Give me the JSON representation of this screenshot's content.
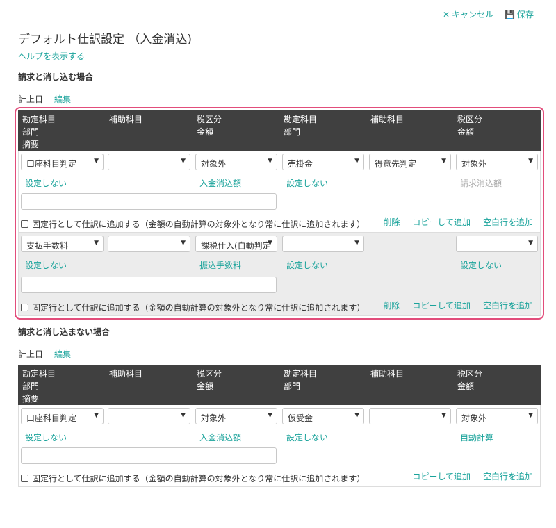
{
  "toolbar": {
    "cancel_label": "キャンセル",
    "save_label": "保存",
    "cancel_icon": "✕",
    "save_icon": "💾"
  },
  "page": {
    "title": "デフォルト仕訳設定 （入金消込)",
    "help_link": "ヘルプを表示する"
  },
  "headers": {
    "col1": [
      "勘定科目",
      "部門",
      "摘要"
    ],
    "col2": [
      "補助科目"
    ],
    "col3": [
      "税区分",
      "金額"
    ],
    "col4": [
      "勘定科目",
      "部門"
    ],
    "col5": [
      "補助科目"
    ],
    "col6": [
      "税区分",
      "金額"
    ]
  },
  "common": {
    "fixed_row_label": "固定行として仕訳に追加する（金額の自動計算の対象外となり常に仕訳に追加されます）",
    "delete_label": "削除",
    "copy_label": "コピーして追加",
    "blank_label": "空白行を追加",
    "date_label": "計上日",
    "edit_label": "編集"
  },
  "section1": {
    "heading": "請求と消し込む場合",
    "row1": {
      "debit_account": "口座科目判定",
      "debit_sub": "",
      "debit_tax": "対象外",
      "credit_account": "売掛金",
      "credit_sub": "得意先判定",
      "credit_tax": "対象外",
      "debit_dept": "設定しない",
      "debit_amount": "入金消込額",
      "credit_dept": "設定しない",
      "credit_amount": "請求消込額"
    },
    "row2": {
      "debit_account": "支払手数料",
      "debit_sub": "",
      "debit_tax": "課税仕入(自動判定",
      "credit_account": "",
      "credit_sub": "",
      "credit_tax": "",
      "debit_dept": "設定しない",
      "debit_amount": "振込手数料",
      "credit_dept": "設定しない",
      "credit_amount": "設定しない"
    }
  },
  "section2": {
    "heading": "請求と消し込まない場合",
    "row1": {
      "debit_account": "口座科目判定",
      "debit_sub": "",
      "debit_tax": "対象外",
      "credit_account": "仮受金",
      "credit_sub": "",
      "credit_tax": "対象外",
      "debit_dept": "設定しない",
      "debit_amount": "入金消込額",
      "credit_dept": "設定しない",
      "credit_amount": "自動計算"
    }
  }
}
